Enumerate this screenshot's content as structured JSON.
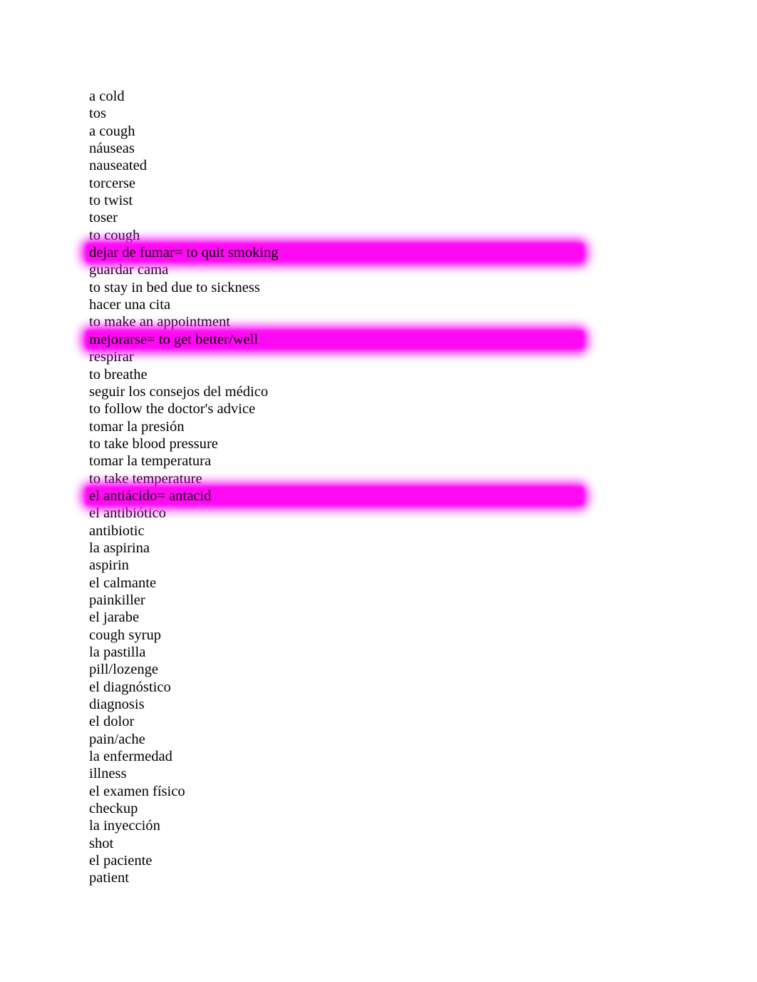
{
  "document": {
    "title": "Spanish Medical Vocabulary List",
    "background_color": "#ffffff",
    "text_color": "#000000",
    "highlight_color": "#ff00ff"
  },
  "vocabulary": {
    "lines": [
      {
        "text": "a cold",
        "highlighted": false
      },
      {
        "text": "tos",
        "highlighted": false
      },
      {
        "text": "a cough",
        "highlighted": false
      },
      {
        "text": "náuseas",
        "highlighted": false
      },
      {
        "text": "nauseated",
        "highlighted": false
      },
      {
        "text": "torcerse",
        "highlighted": false
      },
      {
        "text": "to twist",
        "highlighted": false
      },
      {
        "text": "toser",
        "highlighted": false
      },
      {
        "text": "to cough",
        "highlighted": false
      },
      {
        "text": "dejar de fumar= to quit smoking",
        "highlighted": true
      },
      {
        "text": "guardar cama",
        "highlighted": false
      },
      {
        "text": "to stay in bed due to sickness",
        "highlighted": false
      },
      {
        "text": "hacer una cita",
        "highlighted": false
      },
      {
        "text": "to make an appointment",
        "highlighted": false
      },
      {
        "text": "mejorarse= to get better/well",
        "highlighted": true
      },
      {
        "text": "respirar",
        "highlighted": false
      },
      {
        "text": "to breathe",
        "highlighted": false
      },
      {
        "text": "seguir los consejos del médico",
        "highlighted": false
      },
      {
        "text": "to follow the doctor's advice",
        "highlighted": false
      },
      {
        "text": "tomar la presión",
        "highlighted": false
      },
      {
        "text": "to take blood pressure",
        "highlighted": false
      },
      {
        "text": "tomar la temperatura",
        "highlighted": false
      },
      {
        "text": "to take temperature",
        "highlighted": false
      },
      {
        "text": "el antiácido= antacid",
        "highlighted": true
      },
      {
        "text": "el antibiótico",
        "highlighted": false
      },
      {
        "text": "antibiotic",
        "highlighted": false
      },
      {
        "text": "la aspirina",
        "highlighted": false
      },
      {
        "text": "aspirin",
        "highlighted": false
      },
      {
        "text": "el calmante",
        "highlighted": false
      },
      {
        "text": "painkiller",
        "highlighted": false
      },
      {
        "text": "el jarabe",
        "highlighted": false
      },
      {
        "text": "cough syrup",
        "highlighted": false
      },
      {
        "text": "la pastilla",
        "highlighted": false
      },
      {
        "text": "pill/lozenge",
        "highlighted": false
      },
      {
        "text": "el diagnóstico",
        "highlighted": false
      },
      {
        "text": "diagnosis",
        "highlighted": false
      },
      {
        "text": "el dolor",
        "highlighted": false
      },
      {
        "text": "pain/ache",
        "highlighted": false
      },
      {
        "text": "la enfermedad",
        "highlighted": false
      },
      {
        "text": "illness",
        "highlighted": false
      },
      {
        "text": "el examen físico",
        "highlighted": false
      },
      {
        "text": "checkup",
        "highlighted": false
      },
      {
        "text": "la inyección",
        "highlighted": false
      },
      {
        "text": "shot",
        "highlighted": false
      },
      {
        "text": "el paciente",
        "highlighted": false
      },
      {
        "text": "patient",
        "highlighted": false
      }
    ]
  }
}
